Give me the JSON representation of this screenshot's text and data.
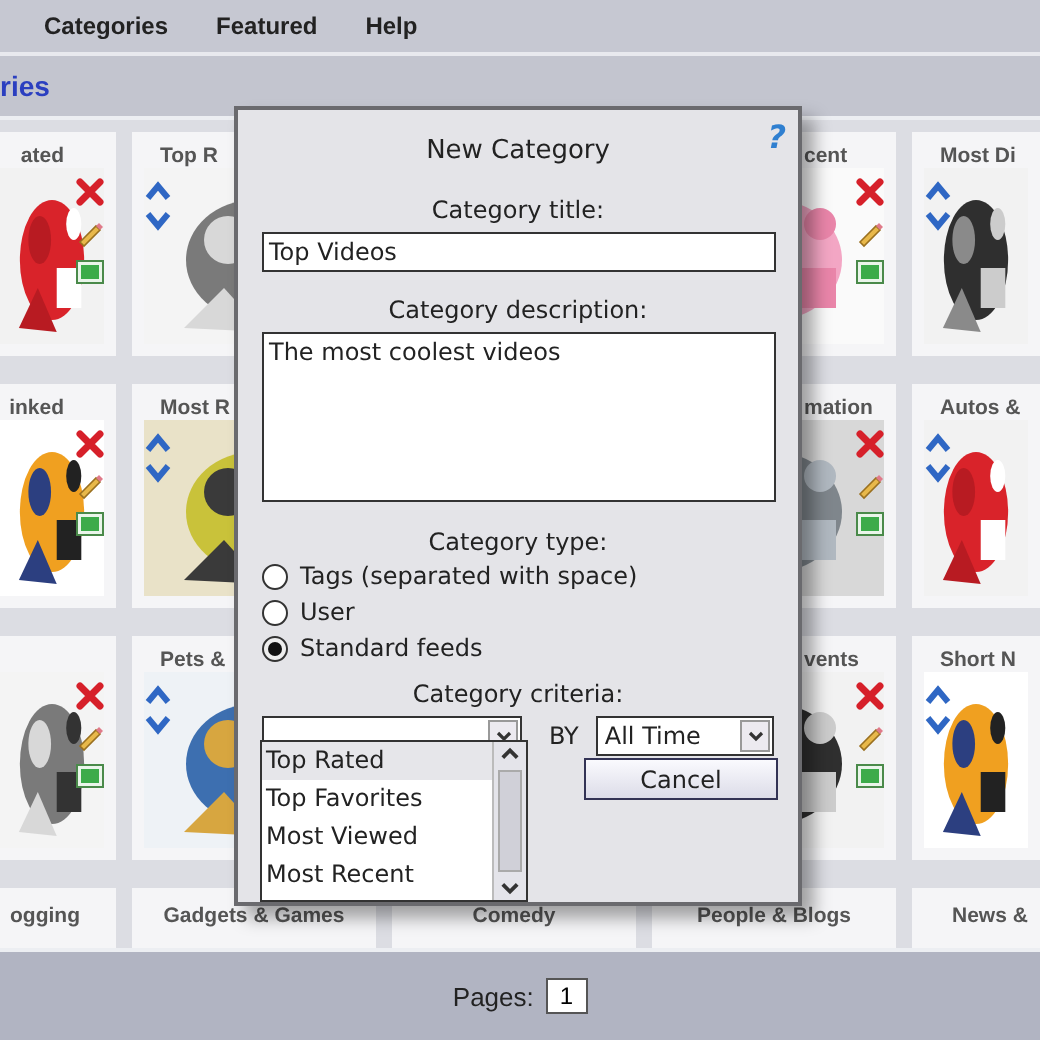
{
  "menu": [
    {
      "label": "Categories"
    },
    {
      "label": "Featured"
    },
    {
      "label": "Help"
    }
  ],
  "page_title": "ries",
  "card_rows": [
    [
      {
        "title": "ated",
        "picture": {
          "kind": "picture"
        }
      },
      {
        "title": "Top R",
        "picture": {
          "kind": "picture"
        }
      },
      null,
      {
        "title": "cent",
        "picture": {
          "kind": "picture"
        }
      },
      {
        "title": "Most Di",
        "picture": {
          "kind": "picture"
        }
      }
    ],
    [
      {
        "title": "inked",
        "picture": {
          "kind": "picture"
        }
      },
      {
        "title": "Most R",
        "picture": {
          "kind": "picture"
        }
      },
      null,
      {
        "title": "mation",
        "picture": {
          "kind": "picture"
        }
      },
      {
        "title": "Autos &",
        "picture": {
          "kind": "picture"
        }
      }
    ],
    [
      {
        "picture": {
          "kind": "picture"
        }
      },
      {
        "title": "Pets &",
        "picture": {
          "kind": "picture"
        }
      },
      null,
      {
        "title": "vents",
        "picture": {
          "kind": "picture"
        }
      },
      {
        "title": "Short N",
        "picture": {
          "kind": "picture"
        }
      }
    ],
    [
      {
        "title": "ogging"
      },
      {
        "title": "Gadgets & Games"
      },
      {
        "title": "Comedy"
      },
      {
        "title": "People & Blogs"
      },
      {
        "title": "News &"
      }
    ]
  ],
  "dialog": {
    "title": "New Category",
    "help": "?",
    "title_label": "Category title:",
    "title_value": "Top Videos",
    "description_label": "Category description:",
    "description_value": "The most coolest videos",
    "type_label": "Category type:",
    "types": [
      {
        "label": "Tags (separated with space)",
        "selected": false
      },
      {
        "label": "User",
        "selected": false
      },
      {
        "label": "Standard feeds",
        "selected": true
      }
    ],
    "criteria_label": "Category criteria:",
    "criteria_options": [
      {
        "label": "Top Rated",
        "selected": true
      },
      {
        "label": "Top Favorites",
        "selected": false
      },
      {
        "label": "Most Viewed",
        "selected": false
      },
      {
        "label": "Most Recent",
        "selected": false
      }
    ],
    "by_label": "BY",
    "period_value": "All Time",
    "cancel": "Cancel"
  },
  "pager": {
    "label": "Pages:",
    "value": "1"
  }
}
